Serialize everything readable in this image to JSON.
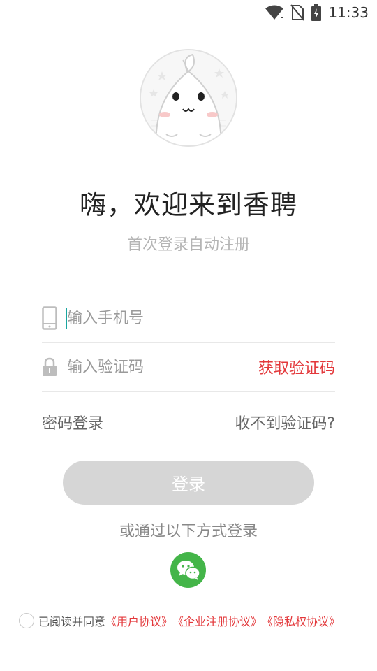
{
  "status_bar": {
    "time": "11:33",
    "icons": [
      "wifi-icon",
      "no-sim-icon",
      "battery-charging-icon"
    ]
  },
  "avatar": {
    "icon": "cartoon-avatar-icon"
  },
  "welcome": {
    "title": "嗨，欢迎来到香聘",
    "subtitle": "首次登录自动注册"
  },
  "form": {
    "phone_placeholder": "输入手机号",
    "phone_value": "",
    "phone_icon": "phone-icon",
    "code_placeholder": "输入验证码",
    "code_value": "",
    "code_icon": "lock-icon",
    "get_code_label": "获取验证码"
  },
  "options": {
    "password_login": "密码登录",
    "no_code": "收不到验证码?"
  },
  "login_button": {
    "label": "登录",
    "enabled": false
  },
  "alt_login": {
    "label": "或通过以下方式登录",
    "wechat_icon": "wechat-icon"
  },
  "agreement": {
    "checked": false,
    "prefix": "已阅读并同意",
    "links": [
      "《用户协议》",
      "《企业注册协议》",
      "《隐私权协议》"
    ]
  },
  "colors": {
    "accent_red": "#e3383b",
    "wechat_green": "#44b549",
    "button_disabled": "#d6d6d6",
    "caret": "#1aa6a0"
  }
}
